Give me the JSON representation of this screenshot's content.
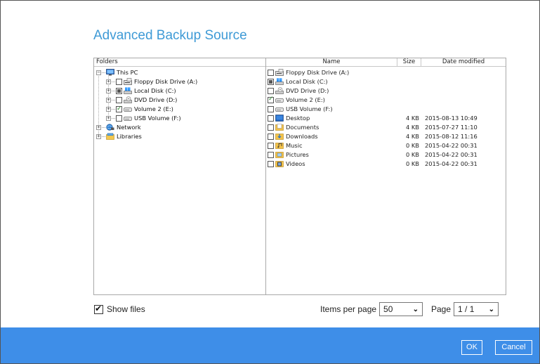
{
  "dialog": {
    "title": "Advanced Backup Source"
  },
  "folders_pane": {
    "header": "Folders",
    "nodes": [
      {
        "label": "This PC",
        "icon": "computer-icon",
        "expander": "-",
        "checkbox": "none"
      },
      {
        "label": "Floppy Disk Drive (A:)",
        "icon": "floppy-drive-icon",
        "expander": "+",
        "checkbox": "unchecked"
      },
      {
        "label": "Local Disk (C:)",
        "icon": "windows-disk-icon",
        "expander": "+",
        "checkbox": "partial"
      },
      {
        "label": "DVD Drive (D:)",
        "icon": "dvd-drive-icon",
        "expander": "+",
        "checkbox": "unchecked"
      },
      {
        "label": "Volume 2 (E:)",
        "icon": "drive-icon",
        "expander": "+",
        "checkbox": "checked"
      },
      {
        "label": "USB Volume (F:)",
        "icon": "drive-icon",
        "expander": "+",
        "checkbox": "unchecked"
      },
      {
        "label": "Network",
        "icon": "network-icon",
        "expander": "+",
        "checkbox": "none"
      },
      {
        "label": "Libraries",
        "icon": "libraries-icon",
        "expander": "+",
        "checkbox": "none"
      }
    ]
  },
  "files_pane": {
    "columns": {
      "name": "Name",
      "size": "Size",
      "date": "Date modified"
    },
    "rows": [
      {
        "name": "Floppy Disk Drive (A:)",
        "icon": "floppy-drive-icon",
        "checkbox": "unchecked",
        "size": "",
        "date": ""
      },
      {
        "name": "Local Disk (C:)",
        "icon": "windows-disk-icon",
        "checkbox": "partial",
        "size": "",
        "date": ""
      },
      {
        "name": "DVD Drive (D:)",
        "icon": "dvd-drive-icon",
        "checkbox": "unchecked",
        "size": "",
        "date": ""
      },
      {
        "name": "Volume 2 (E:)",
        "icon": "drive-icon",
        "checkbox": "checked",
        "size": "",
        "date": ""
      },
      {
        "name": "USB Volume (F:)",
        "icon": "drive-icon",
        "checkbox": "unchecked",
        "size": "",
        "date": ""
      },
      {
        "name": "Desktop",
        "icon": "desktop-folder-icon",
        "checkbox": "unchecked",
        "size": "4 KB",
        "date": "2015-08-13 10:49"
      },
      {
        "name": "Documents",
        "icon": "documents-folder-icon",
        "checkbox": "unchecked",
        "size": "4 KB",
        "date": "2015-07-27 11:10"
      },
      {
        "name": "Downloads",
        "icon": "downloads-folder-icon",
        "checkbox": "unchecked",
        "size": "4 KB",
        "date": "2015-08-12 11:16"
      },
      {
        "name": "Music",
        "icon": "music-folder-icon",
        "checkbox": "unchecked",
        "size": "0 KB",
        "date": "2015-04-22 00:31"
      },
      {
        "name": "Pictures",
        "icon": "pictures-folder-icon",
        "checkbox": "unchecked",
        "size": "0 KB",
        "date": "2015-04-22 00:31"
      },
      {
        "name": "Videos",
        "icon": "videos-folder-icon",
        "checkbox": "unchecked",
        "size": "0 KB",
        "date": "2015-04-22 00:31"
      }
    ]
  },
  "controls": {
    "show_files_label": "Show files",
    "show_files_checked": true,
    "items_per_page_label": "Items per page",
    "items_per_page_value": "50",
    "page_label": "Page",
    "page_value": "1 / 1"
  },
  "footer": {
    "ok_label": "OK",
    "cancel_label": "Cancel"
  },
  "colors": {
    "title": "#3e9ad6",
    "footer": "#3e8ee8"
  }
}
